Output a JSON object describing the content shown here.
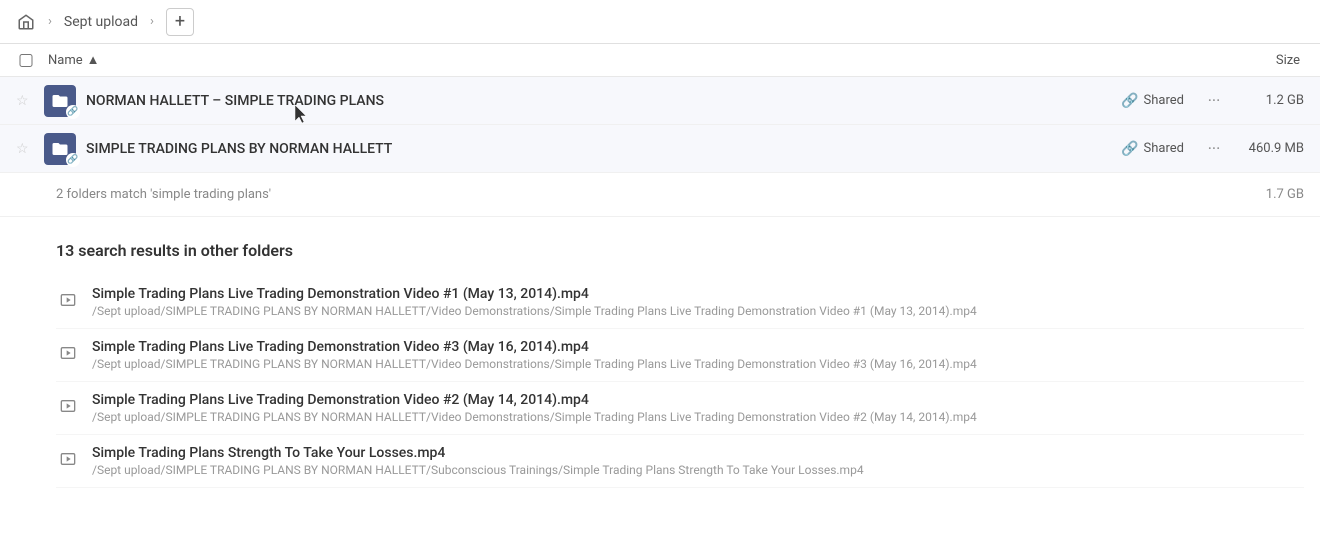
{
  "nav": {
    "home_label": "Home",
    "breadcrumb_label": "Sept upload",
    "add_button_label": "+"
  },
  "columns": {
    "name_label": "Name",
    "sort_indicator": "▲",
    "size_label": "Size"
  },
  "folders": [
    {
      "id": 1,
      "name": "NORMAN HALLETT – SIMPLE TRADING PLANS",
      "shared": true,
      "shared_label": "Shared",
      "size": "1.2 GB",
      "starred": false
    },
    {
      "id": 2,
      "name": "SIMPLE TRADING PLANS BY NORMAN HALLETT",
      "shared": true,
      "shared_label": "Shared",
      "size": "460.9 MB",
      "starred": false
    }
  ],
  "summary": {
    "text": "2 folders match 'simple trading plans'",
    "total_size": "1.7 GB"
  },
  "other_folders": {
    "title": "13 search results in other folders",
    "results": [
      {
        "id": 1,
        "filename": "Simple Trading Plans Live Trading Demonstration Video #1 (May 13, 2014).mp4",
        "path": "/Sept upload/SIMPLE TRADING PLANS BY NORMAN HALLETT/Video Demonstrations/Simple Trading Plans Live Trading Demonstration Video #1 (May 13, 2014).mp4"
      },
      {
        "id": 2,
        "filename": "Simple Trading Plans Live Trading Demonstration Video #3 (May 16, 2014).mp4",
        "path": "/Sept upload/SIMPLE TRADING PLANS BY NORMAN HALLETT/Video Demonstrations/Simple Trading Plans Live Trading Demonstration Video #3 (May 16, 2014).mp4"
      },
      {
        "id": 3,
        "filename": "Simple Trading Plans Live Trading Demonstration Video #2 (May 14, 2014).mp4",
        "path": "/Sept upload/SIMPLE TRADING PLANS BY NORMAN HALLETT/Video Demonstrations/Simple Trading Plans Live Trading Demonstration Video #2 (May 14, 2014).mp4"
      },
      {
        "id": 4,
        "filename": "Simple Trading Plans Strength To Take Your Losses.mp4",
        "path": "/Sept upload/SIMPLE TRADING PLANS BY NORMAN HALLETT/Subconscious Trainings/Simple Trading Plans Strength To Take Your Losses.mp4"
      }
    ]
  },
  "icons": {
    "home": "⌂",
    "chevron_right": "›",
    "sort_up": "↑",
    "link": "🔗",
    "more": "···",
    "play": "▶",
    "folder_link": "🔗"
  }
}
